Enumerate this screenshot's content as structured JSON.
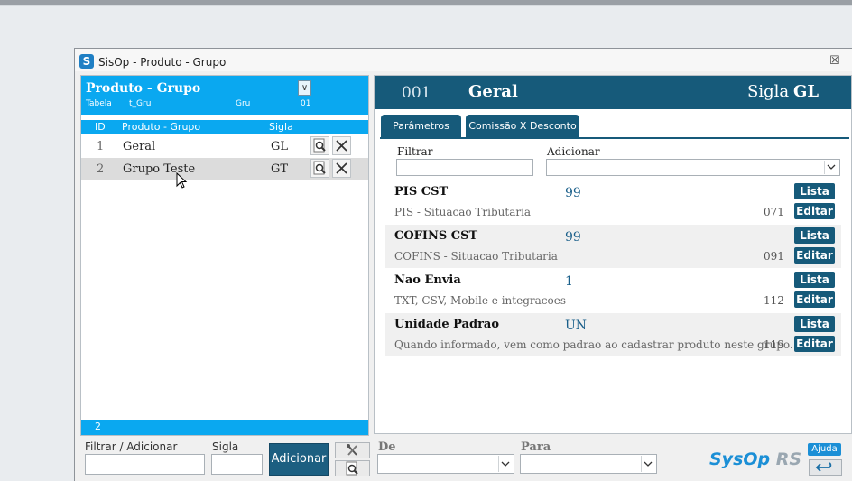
{
  "window": {
    "title": "SisOp - Produto - Grupo",
    "close_glyph": "☒"
  },
  "left": {
    "header_title": "Produto - Grupo",
    "meta": {
      "tabela_label": "Tabela",
      "tabela_value": "t_Gru",
      "prefix": "Gru",
      "code": "01"
    },
    "columns": {
      "id": "ID",
      "name": "Produto - Grupo",
      "sigla": "Sigla"
    },
    "rows": [
      {
        "id": "1",
        "name": "Geral",
        "sigla": "GL"
      },
      {
        "id": "2",
        "name": "Grupo Teste",
        "sigla": "GT"
      }
    ],
    "footer_count": "2"
  },
  "bottom": {
    "filter_label": "Filtrar / Adicionar",
    "filter_value": "",
    "sigla_label": "Sigla",
    "sigla_value": "",
    "add_button": "Adicionar",
    "de_label": "De",
    "para_label": "Para"
  },
  "right": {
    "code": "001",
    "name": "Geral",
    "sigla_label": "Sigla",
    "sigla_value": "GL",
    "tabs": [
      {
        "label": "Parâmetros",
        "active": true
      },
      {
        "label": "Comissão X Desconto",
        "active": false
      }
    ],
    "filtrar_label": "Filtrar",
    "adicionar_label": "Adicionar",
    "params": [
      {
        "title": "PIS CST",
        "value": "99",
        "desc": "PIS - Situacao Tributaria",
        "num": "071"
      },
      {
        "title": "COFINS CST",
        "value": "99",
        "desc": "COFINS - Situacao Tributaria",
        "num": "091"
      },
      {
        "title": "Nao Envia",
        "value": "1",
        "desc": "TXT, CSV, Mobile e integracoes",
        "num": "112"
      },
      {
        "title": "Unidade Padrao",
        "value": "UN",
        "desc": "Quando informado, vem como padrao ao cadastrar produto neste grupo.",
        "num": "119"
      }
    ],
    "lista_label": "Lista",
    "editar_label": "Editar"
  },
  "brand": {
    "logo_main": "SysOp",
    "logo_suffix": "RS",
    "help": "Ajuda"
  },
  "colors": {
    "accent": "#0aa8f0",
    "dark": "#165a7a"
  }
}
